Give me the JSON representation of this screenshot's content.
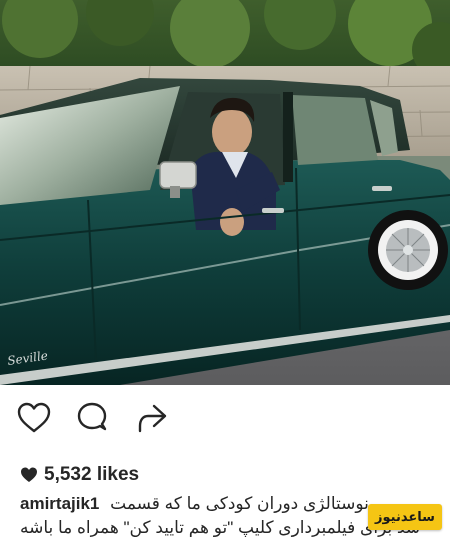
{
  "post": {
    "likes_count": "5,532 likes",
    "username": "amirtajik1",
    "caption_line_1": "نوستالژی دوران کودکی ما که قسمت",
    "caption_line_2": "شد برای فیلمبرداری کلیپ \"تو هم تایید کن\" همراه ما باشه",
    "car_badge": "Seville"
  },
  "watermark": {
    "text": "ساعدنیوز"
  },
  "icons": {
    "like": "heart-outline-icon",
    "comment": "speech-bubble-icon",
    "share": "share-arrow-icon",
    "likes_marker": "heart-filled-icon"
  },
  "colors": {
    "car_body": "#0f3d3a",
    "text": "#262626",
    "watermark_bg": "#f5c514"
  }
}
